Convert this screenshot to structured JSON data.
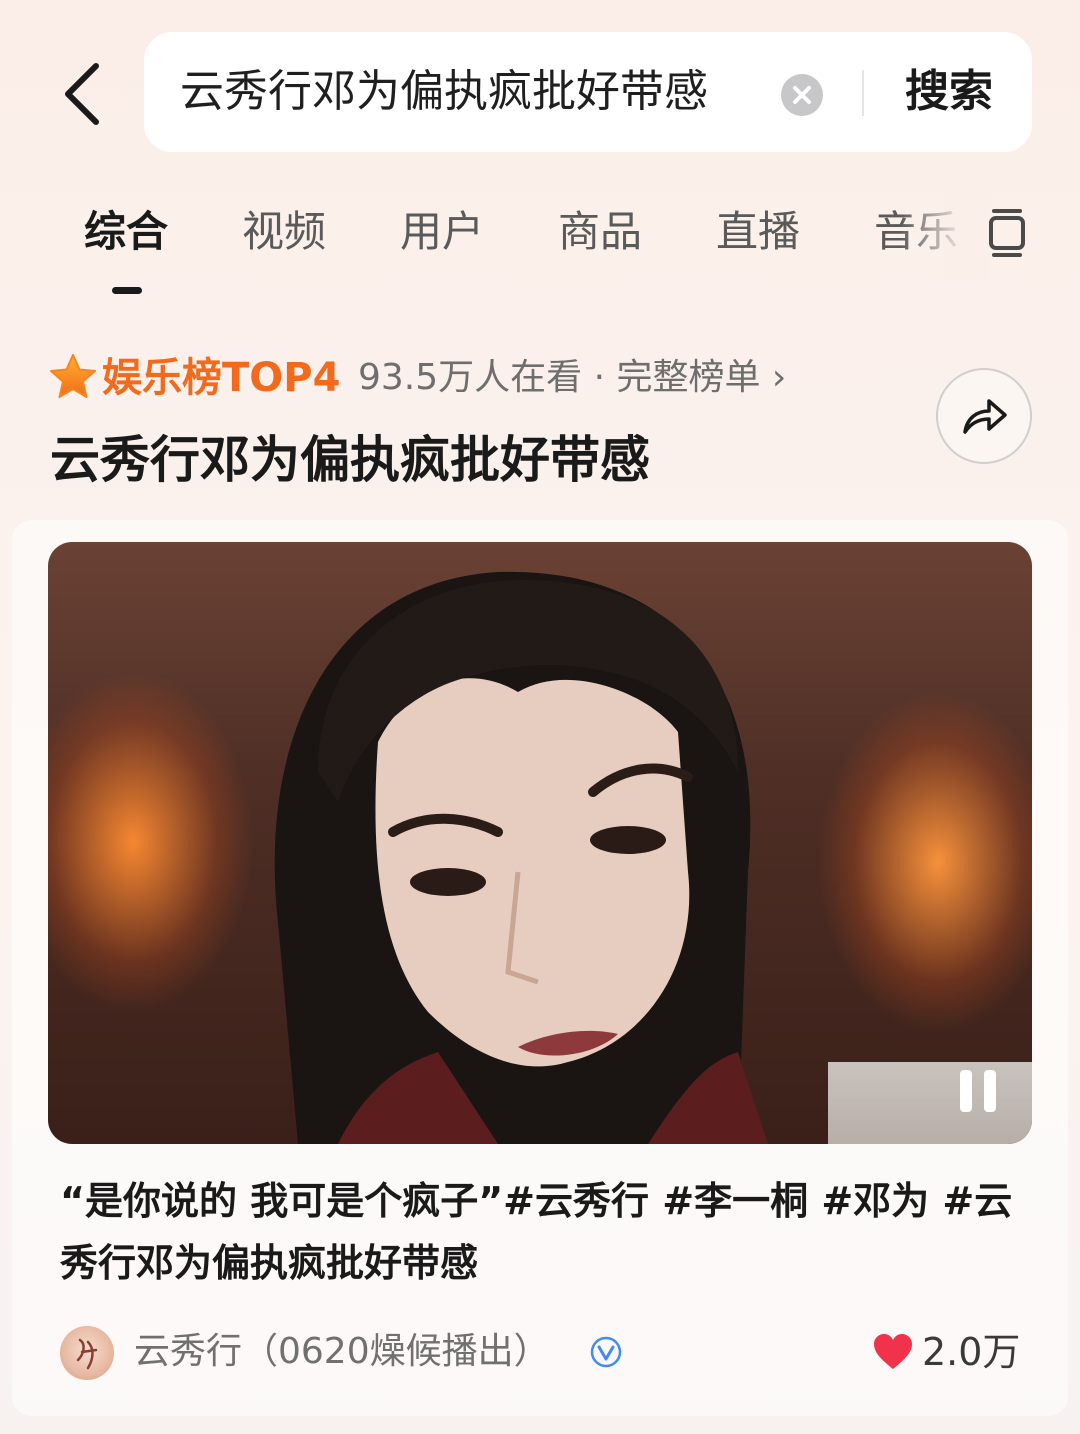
{
  "search": {
    "query": "云秀行邓为偏执疯批好带感",
    "button_label": "搜索"
  },
  "tabs": [
    {
      "label": "综合",
      "active": true
    },
    {
      "label": "视频",
      "active": false
    },
    {
      "label": "用户",
      "active": false
    },
    {
      "label": "商品",
      "active": false
    },
    {
      "label": "直播",
      "active": false
    },
    {
      "label": "音乐",
      "active": false
    }
  ],
  "ranking": {
    "label": "娱乐榜TOP4",
    "info": "93.5万人在看 · 完整榜单 ›",
    "title": "云秀行邓为偏执疯批好带感"
  },
  "video": {
    "state": "playing"
  },
  "post": {
    "caption": "“是你说的 我可是个疯子”#云秀行 #李一桐 #邓为 #云秀行邓为偏执疯批好带感",
    "author": "云秀行（0620燥候播出）",
    "likes": "2.0万"
  },
  "colors": {
    "accent_orange": "#f26a1b",
    "like_red": "#f0324a",
    "verified_blue": "#3f8cf5"
  },
  "icons": [
    "back-arrow-icon",
    "clear-icon",
    "menu-icon",
    "star-icon",
    "share-icon",
    "pause-icon",
    "verified-icon",
    "heart-icon"
  ]
}
